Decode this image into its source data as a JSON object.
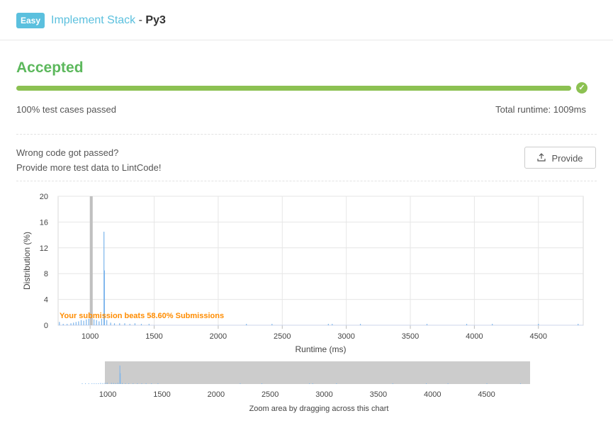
{
  "header": {
    "difficulty": "Easy",
    "problem_title": "Implement Stack",
    "separator": "-",
    "language": "Py3"
  },
  "result": {
    "status": "Accepted",
    "progress_percent": 100,
    "passed_text": "100%  test cases passed",
    "runtime_text": "Total runtime: 1009ms",
    "colors": {
      "accepted": "#5cb85c",
      "progress": "#8cc152"
    }
  },
  "feedback": {
    "line1": "Wrong code got passed?",
    "line2": "Provide more test data to LintCode!",
    "provide_label": "Provide",
    "provide_icon": "upload-icon"
  },
  "chart_data": {
    "type": "bar",
    "xlabel": "Runtime (ms)",
    "ylabel": "Distribution (%)",
    "xlim": [
      750,
      4850
    ],
    "ylim": [
      0,
      20
    ],
    "x_ticks": [
      1000,
      1500,
      2000,
      2500,
      3000,
      3500,
      4000,
      4500
    ],
    "y_ticks": [
      0,
      4,
      8,
      12,
      16,
      20
    ],
    "grid": true,
    "marker_x": 1009,
    "annotation": "Your submission beats 58.60% Submissions",
    "bars": [
      {
        "x": 760,
        "y": 0.5
      },
      {
        "x": 790,
        "y": 0.2
      },
      {
        "x": 820,
        "y": 0.2
      },
      {
        "x": 850,
        "y": 0.3
      },
      {
        "x": 870,
        "y": 0.4
      },
      {
        "x": 890,
        "y": 0.5
      },
      {
        "x": 910,
        "y": 0.6
      },
      {
        "x": 930,
        "y": 0.8
      },
      {
        "x": 950,
        "y": 0.7
      },
      {
        "x": 970,
        "y": 0.9
      },
      {
        "x": 990,
        "y": 1.0
      },
      {
        "x": 1030,
        "y": 0.9
      },
      {
        "x": 1050,
        "y": 0.8
      },
      {
        "x": 1070,
        "y": 0.6
      },
      {
        "x": 1090,
        "y": 1.0
      },
      {
        "x": 1108,
        "y": 14.5
      },
      {
        "x": 1112,
        "y": 8.5
      },
      {
        "x": 1130,
        "y": 0.8
      },
      {
        "x": 1160,
        "y": 0.4
      },
      {
        "x": 1190,
        "y": 0.3
      },
      {
        "x": 1230,
        "y": 0.3
      },
      {
        "x": 1270,
        "y": 0.3
      },
      {
        "x": 1310,
        "y": 0.2
      },
      {
        "x": 1350,
        "y": 0.3
      },
      {
        "x": 1400,
        "y": 0.2
      },
      {
        "x": 1460,
        "y": 0.2
      },
      {
        "x": 2220,
        "y": 0.2
      },
      {
        "x": 2420,
        "y": 0.2
      },
      {
        "x": 2860,
        "y": 0.2
      },
      {
        "x": 2890,
        "y": 0.2
      },
      {
        "x": 3110,
        "y": 0.2
      },
      {
        "x": 3630,
        "y": 0.2
      },
      {
        "x": 3940,
        "y": 0.2
      },
      {
        "x": 4140,
        "y": 0.2
      },
      {
        "x": 4500,
        "y": 0.2
      },
      {
        "x": 4810,
        "y": 0.2
      }
    ],
    "navigator": {
      "caption": "Zoom area by dragging across this chart",
      "x_ticks": [
        1000,
        1500,
        2000,
        2500,
        3000,
        3500,
        4000,
        4500
      ]
    },
    "colors": {
      "bar": "#7cb5ec",
      "marker": "#c0c0c0",
      "annotation": "#ff8c00",
      "grid": "#e6e6e6",
      "navigator_bg": "#cccccc"
    }
  }
}
